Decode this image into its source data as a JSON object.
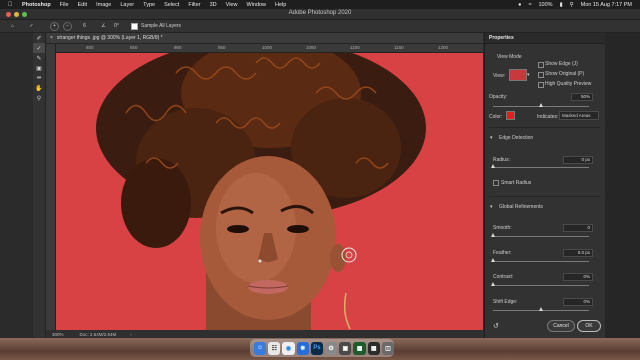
{
  "menubar": {
    "app": "Photoshop",
    "items": [
      "File",
      "Edit",
      "Image",
      "Layer",
      "Type",
      "Select",
      "Filter",
      "3D",
      "View",
      "Window",
      "Help"
    ],
    "battery": "100%",
    "clock": "Mon 15 Aug  7:17 PM"
  },
  "window": {
    "title": "Adobe Photoshop 2020"
  },
  "options": {
    "size_value": "6",
    "angle_value": "0°",
    "sample_all_layers": "Sample All Layers"
  },
  "document": {
    "tab_label": "stranger things .jpg @ 300% (Layer 1, RGB/8) *",
    "ruler_ticks": [
      "800",
      "850",
      "900",
      "950",
      "1000",
      "1050",
      "1100",
      "1150",
      "1200"
    ],
    "zoom": "300%",
    "doc_size": "Doc: 2.64M/2.64M"
  },
  "properties": {
    "header": "Properties",
    "view_mode_label": "View Mode",
    "view_label": "View:",
    "show_edge": "Show Edge (J)",
    "show_original": "Show Original (P)",
    "high_quality": "High Quality Preview",
    "opacity_label": "Opacity:",
    "opacity_value": "50%",
    "opacity_level": 0.5,
    "color_label": "Color:",
    "color_hex": "#e02020",
    "indicates_label": "Indicates:",
    "indicates_value": "Masked Areas",
    "edge_detection": "Edge Detection",
    "radius_label": "Radius:",
    "radius_value": "0 px",
    "smart_radius": "Smart Radius",
    "global_refinements": "Global Refinements",
    "smooth_label": "Smooth:",
    "smooth_value": "0",
    "feather_label": "Feather:",
    "feather_value": "0.0 px",
    "contrast_label": "Contrast:",
    "contrast_value": "0%",
    "shift_edge_label": "Shift Edge:",
    "shift_edge_value": "0%",
    "cancel": "Cancel",
    "ok": "OK"
  },
  "dock": {
    "ps_label": "Ps"
  },
  "colors": {
    "canvas_bg": "#d84245",
    "panel": "#323232"
  }
}
